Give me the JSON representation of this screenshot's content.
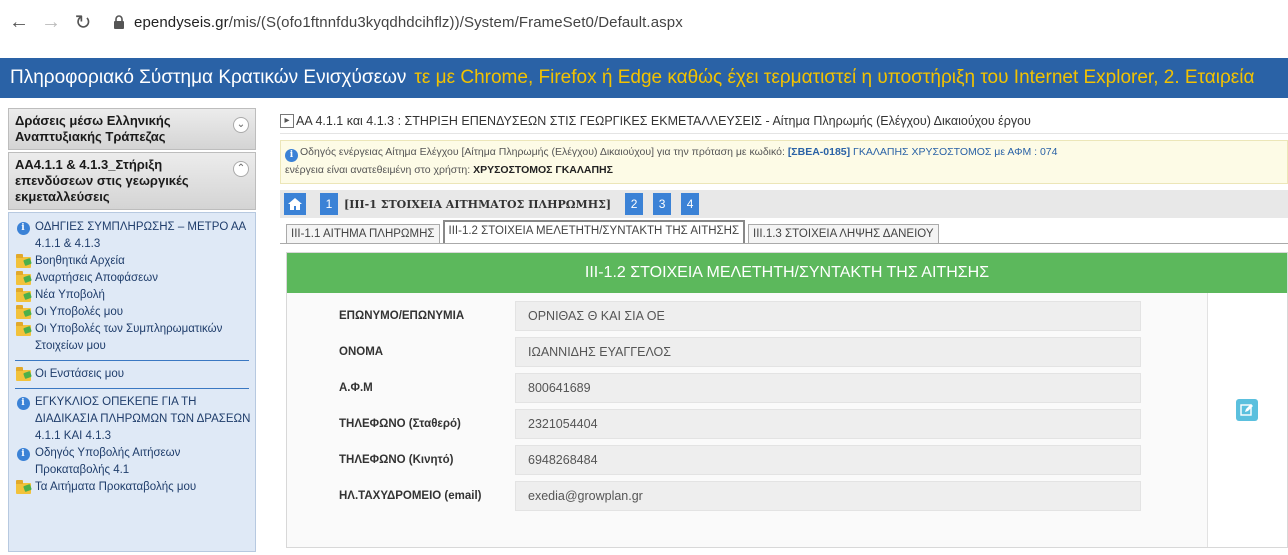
{
  "browser": {
    "url_host": "ependyseis.gr",
    "url_path": "/mis/(S(ofo1ftnnfdu3kyqdhdcihflz))/System/FrameSet0/Default.aspx"
  },
  "header": {
    "app_title": "Πληροφοριακό Σύστημα Κρατικών Ενισχύσεων",
    "marquee_text": "τε με Chrome, Firefox ή Edge καθώς έχει τερματιστεί η υποστήριξη του Internet Explorer, 2. Εταιρεία"
  },
  "sidebar": {
    "sections": [
      {
        "label": "Δράσεις μέσω Ελληνικής Αναπτυξιακής Τράπεζας"
      },
      {
        "label": "ΑΑ4.1.1 & 4.1.3_Στήριξη επενδύσεων στις γεωργικές εκμεταλλεύσεις"
      }
    ],
    "items": [
      {
        "icon": "info-icon",
        "label": "ΟΔΗΓΙΕΣ ΣΥΜΠΛΗΡΩΣΗΣ – ΜΕΤΡΟ ΑΑ 4.1.1 & 4.1.3"
      },
      {
        "icon": "folder-icon",
        "label": "Βοηθητικά Αρχεία"
      },
      {
        "icon": "folder-icon",
        "label": "Αναρτήσεις Αποφάσεων"
      },
      {
        "icon": "folder-icon",
        "label": "Νέα Υποβολή"
      },
      {
        "icon": "folder-icon",
        "label": "Οι Υποβολές μου"
      },
      {
        "icon": "folder-icon",
        "label": "Οι Υποβολές των Συμπληρωματικών Στοιχείων μου"
      },
      {
        "icon": "folder-icon",
        "label": "Οι Ενστάσεις μου"
      },
      {
        "icon": "info-icon",
        "label": "ΕΓΚΥΚΛΙΟΣ ΟΠΕΚΕΠΕ ΓΙΑ ΤΗ ΔΙΑΔΙΚΑΣΙΑ ΠΛΗΡΩΜΩΝ ΤΩΝ ΔΡΑΣΕΩΝ 4.1.1 ΚΑΙ 4.1.3"
      },
      {
        "icon": "info-icon",
        "label": "Οδηγός Υποβολής Αιτήσεων Προκαταβολής 4.1"
      },
      {
        "icon": "folder-icon",
        "label": "Τα Αιτήματα Προκαταβολής μου"
      }
    ]
  },
  "main": {
    "title": "ΑΑ 4.1.1 και 4.1.3 : ΣΤΗΡΙΞΗ ΕΠΕΝΔΥΣΕΩΝ ΣΤΙΣ ΓΕΩΡΓΙΚΕΣ ΕΚΜΕΤΑΛΛΕΥΣΕΙΣ - Αίτημα Πληρωμής (Ελέγχου) Δικαιούχου έργου",
    "notice": {
      "line1_prefix": "Οδηγός ενέργειας Αίτημα Ελέγχου [Αίτημα Πληρωμής (Ελέγχου) Δικαιούχου] για την πρόταση με κωδικό: ",
      "code": "[ΣΒΕΑ-0185]",
      "name": " ΓΚΑΛΑΠΗΣ ΧΡΥΣΟΣΤΟΜΟΣ με ΑΦΜ : 074",
      "line2_prefix": "ενέργεια είναι ανατεθειμένη στο χρήστη: ",
      "assignee": "ΧΡΥΣΟΣΤΟΜΟΣ ΓΚΑΛΑΠΗΣ"
    },
    "steps": {
      "current_number": "1",
      "current_label": "[ΙΙΙ-1 ΣΤΟΙΧΕΙΑ ΑΙΤΗΜΑΤΟΣ ΠΛΗΡΩΜΗΣ]",
      "others": [
        "2",
        "3",
        "4"
      ]
    },
    "tabs": [
      {
        "label": "ΙΙΙ-1.1 ΑΙΤΗΜΑ ΠΛΗΡΩΜΗΣ",
        "active": false
      },
      {
        "label": "ΙΙΙ-1.2 ΣΤΟΙΧΕΙΑ ΜΕΛΕΤΗΤΗ/ΣΥΝΤΑΚΤΗ ΤΗΣ ΑΙΤΗΣΗΣ",
        "active": true
      },
      {
        "label": "ΙΙΙ.1.3 ΣΤΟΙΧΕΙΑ ΛΗΨΗΣ ΔΑΝΕΙΟΥ",
        "active": false
      }
    ],
    "panel": {
      "heading": "ΙΙΙ-1.2 ΣΤΟΙΧΕΙΑ ΜΕΛΕΤΗΤΗ/ΣΥΝΤΑΚΤΗ ΤΗΣ ΑΙΤΗΣΗΣ",
      "fields": [
        {
          "label": "ΕΠΩΝΥΜΟ/ΕΠΩΝΥΜΙΑ",
          "value": "ΟΡΝΙΘΑΣ Θ ΚΑΙ ΣΙΑ ΟΕ"
        },
        {
          "label": "ΟΝΟΜΑ",
          "value": "ΙΩΑΝΝΙΔΗΣ ΕΥΑΓΓΕΛΟΣ"
        },
        {
          "label": "Α.Φ.Μ",
          "value": "800641689"
        },
        {
          "label": "ΤΗΛΕΦΩΝΟ (Σταθερό)",
          "value": "2321054404"
        },
        {
          "label": "ΤΗΛΕΦΩΝΟ (Κινητό)",
          "value": "6948268484"
        },
        {
          "label": "ΗΛ.ΤΑΧΥΔΡΟΜΕΙΟ (email)",
          "value": "exedia@growplan.gr"
        }
      ]
    }
  },
  "colors": {
    "header_blue": "#2a62a6",
    "marquee_yellow": "#f2c200",
    "panel_green": "#5cb85c",
    "step_blue": "#3b82d6",
    "edit_cyan": "#5bc0de"
  }
}
